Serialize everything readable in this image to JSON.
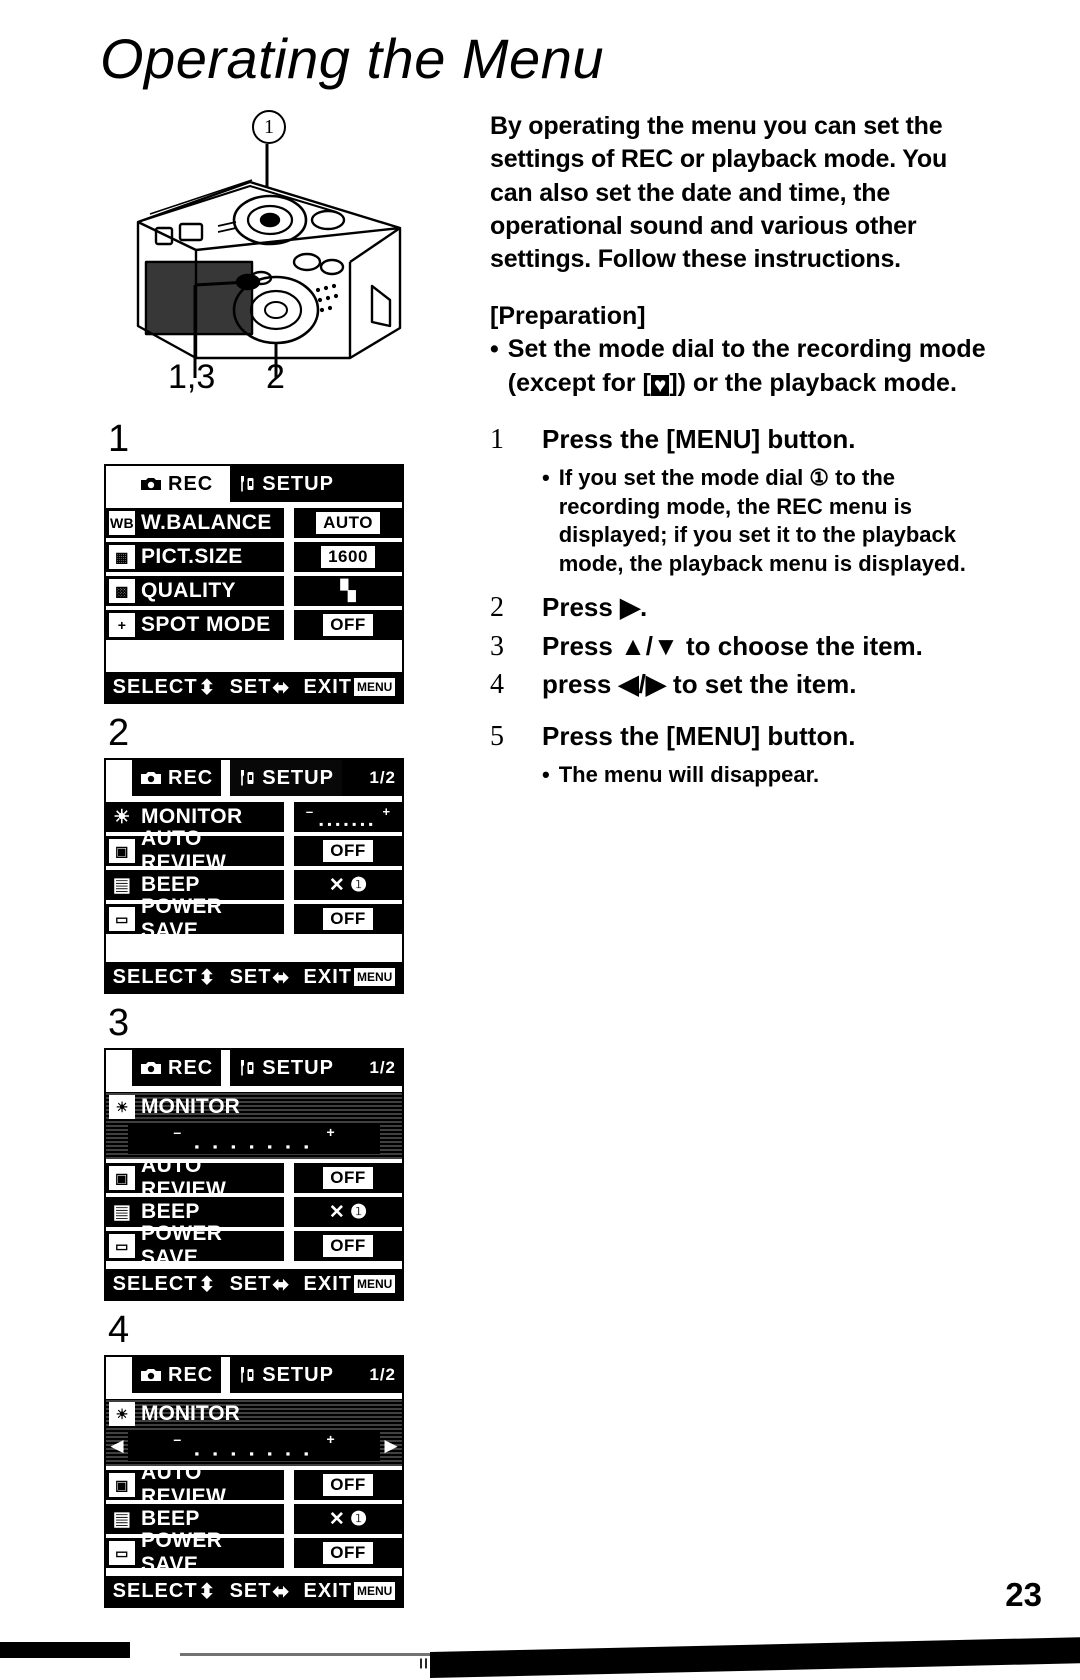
{
  "document": {
    "title": "Operating the Menu",
    "page_number": "23"
  },
  "figure": {
    "callout_top": "1",
    "label_left": "1,3",
    "label_right": "2",
    "alt": "camera-rear-view-line-drawing"
  },
  "intro": {
    "paragraph": "By operating the menu you can set the settings of REC or playback mode. You can also set the date and time, the operational sound and various other settings. Follow these instructions.",
    "preparation_heading": "[Preparation]",
    "preparation_bullet_part1": "Set the mode dial to the recording mode (except for [",
    "preparation_bullet_part2": "]) or the playback mode.",
    "bullet_char": "•",
    "heart_icon": "♥"
  },
  "steps": [
    {
      "num": "1",
      "text": "Press the [MENU] button.",
      "note": "If you set the  mode dial ① to the recording mode,  the REC menu is displayed; if you set it to the playback mode, the playback menu is displayed."
    },
    {
      "num": "2",
      "text": "Press ▶.",
      "note": ""
    },
    {
      "num": "3",
      "text": "Press ▲/▼ to choose the item.",
      "note": ""
    },
    {
      "num": "4",
      "text": "press ◀/▶ to set the item.",
      "note": ""
    },
    {
      "num": "5",
      "text": "Press the [MENU] button.",
      "note": "The menu will disappear."
    }
  ],
  "screens": [
    {
      "index": "1",
      "tabs": {
        "rec_label": "REC",
        "rec_icon": "camera-icon",
        "setup_label": "SETUP",
        "setup_icon": "wrench-icon",
        "active": "REC",
        "page_indicator": ""
      },
      "rows": [
        {
          "icon": "WB",
          "icon_name": "white-balance-icon",
          "label": "W.BALANCE",
          "value": "AUTO",
          "value_style": "chip"
        },
        {
          "icon": "▦",
          "icon_name": "picture-size-icon",
          "label": "PICT.SIZE",
          "value": "1600",
          "value_style": "chip"
        },
        {
          "icon": "▩",
          "icon_name": "quality-icon",
          "label": "QUALITY",
          "value": "▚",
          "value_style": "glyph"
        },
        {
          "icon": "+",
          "icon_name": "spot-mode-icon",
          "label": "SPOT MODE",
          "value": "OFF",
          "value_style": "chip"
        }
      ],
      "footer": {
        "select": "SELECT",
        "select_arrows": "⬍",
        "set": "SET",
        "set_arrows": "⬌",
        "exit": "EXIT",
        "menu_chip": "MENU"
      }
    },
    {
      "index": "2",
      "tabs": {
        "rec_label": "REC",
        "rec_icon": "camera-icon",
        "setup_label": "SETUP",
        "setup_icon": "wrench-icon",
        "active": "SETUP",
        "page_indicator": "1/2"
      },
      "rows": [
        {
          "icon": "☀",
          "icon_name": "monitor-brightness-icon",
          "label": "MONITOR",
          "value": "slider",
          "value_style": "slider"
        },
        {
          "icon": "▣",
          "icon_name": "auto-review-icon",
          "label": "AUTO REVIEW",
          "value": "OFF",
          "value_style": "chip"
        },
        {
          "icon": "▤",
          "icon_name": "beep-icon",
          "label": "BEEP",
          "value": "✕ ❶",
          "value_style": "glyph"
        },
        {
          "icon": "▭",
          "icon_name": "power-save-icon",
          "label": "POWER SAVE",
          "value": "OFF",
          "value_style": "chip"
        }
      ],
      "footer": {
        "select": "SELECT",
        "select_arrows": "⬍",
        "set": "SET",
        "set_arrows": "⬌",
        "exit": "EXIT",
        "menu_chip": "MENU"
      }
    },
    {
      "index": "3",
      "tabs": {
        "rec_label": "REC",
        "rec_icon": "camera-icon",
        "setup_label": "SETUP",
        "setup_icon": "wrench-icon",
        "active": "SETUP",
        "page_indicator": "1/2"
      },
      "selected_row": {
        "icon": "☀",
        "icon_name": "monitor-brightness-icon",
        "label": "MONITOR",
        "minus": "–",
        "plus": "+",
        "ticks": "▪ ▪ ▪ ▪ ▪ ▪ ▪",
        "arrows": false
      },
      "rows": [
        {
          "icon": "▣",
          "icon_name": "auto-review-icon",
          "label": "AUTO REVIEW",
          "value": "OFF",
          "value_style": "chip"
        },
        {
          "icon": "▤",
          "icon_name": "beep-icon",
          "label": "BEEP",
          "value": "✕ ❶",
          "value_style": "glyph"
        },
        {
          "icon": "▭",
          "icon_name": "power-save-icon",
          "label": "POWER SAVE",
          "value": "OFF",
          "value_style": "chip"
        }
      ],
      "footer": {
        "select": "SELECT",
        "select_arrows": "⬍",
        "set": "SET",
        "set_arrows": "⬌",
        "exit": "EXIT",
        "menu_chip": "MENU"
      }
    },
    {
      "index": "4",
      "tabs": {
        "rec_label": "REC",
        "rec_icon": "camera-icon",
        "setup_label": "SETUP",
        "setup_icon": "wrench-icon",
        "active": "SETUP",
        "page_indicator": "1/2"
      },
      "selected_row": {
        "icon": "☀",
        "icon_name": "monitor-brightness-icon",
        "label": "MONITOR",
        "minus": "–",
        "plus": "+",
        "ticks": "▪ ▪ ▪ ▪ ▪ ▪ ▪",
        "arrows": true,
        "arrow_left": "◀",
        "arrow_right": "▶"
      },
      "rows": [
        {
          "icon": "▣",
          "icon_name": "auto-review-icon",
          "label": "AUTO REVIEW",
          "value": "OFF",
          "value_style": "chip"
        },
        {
          "icon": "▤",
          "icon_name": "beep-icon",
          "label": "BEEP",
          "value": "✕ ❶",
          "value_style": "glyph"
        },
        {
          "icon": "▭",
          "icon_name": "power-save-icon",
          "label": "POWER SAVE",
          "value": "OFF",
          "value_style": "chip"
        }
      ],
      "footer": {
        "select": "SELECT",
        "select_arrows": "⬍",
        "set": "SET",
        "set_arrows": "⬌",
        "exit": "EXIT",
        "menu_chip": "MENU"
      }
    }
  ]
}
